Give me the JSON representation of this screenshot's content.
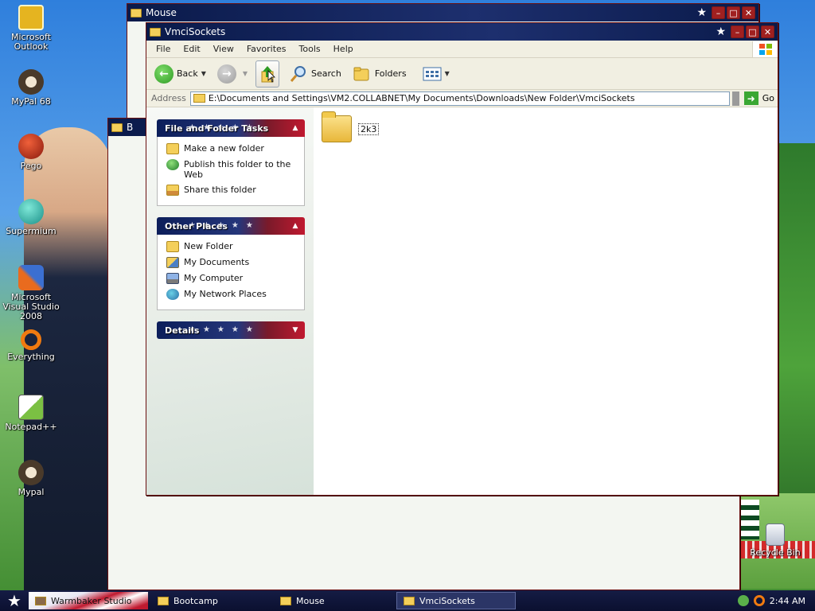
{
  "desktop": {
    "icons": [
      {
        "label": "Microsoft Outlook",
        "icon": "outlook-icon",
        "color": "#e5b420"
      },
      {
        "label": "MyPal 68",
        "icon": "raccoon-icon",
        "color": "#4a3a2a"
      },
      {
        "label": "Pego",
        "icon": "pego-icon",
        "color": "#c0301e"
      },
      {
        "label": "Supermium",
        "icon": "supermium-icon",
        "color": "#2ab7b0"
      },
      {
        "label": "Microsoft Visual Studio 2008",
        "icon": "visual-studio-icon",
        "color": "#e96b1e"
      },
      {
        "label": "Everything",
        "icon": "everything-icon",
        "color": "#f07a10"
      },
      {
        "label": "Notepad++",
        "icon": "notepadpp-icon",
        "color": "#7bc043"
      },
      {
        "label": "Mypal",
        "icon": "raccoon-icon",
        "color": "#4a3a2a"
      },
      {
        "label": "Recycle Bin",
        "icon": "recycle-bin-icon",
        "color": "#d8dde6"
      }
    ]
  },
  "back_windows": [
    {
      "title": "Mouse"
    },
    {
      "title": "B"
    }
  ],
  "window": {
    "title": "VmciSockets",
    "menu": [
      "File",
      "Edit",
      "View",
      "Favorites",
      "Tools",
      "Help"
    ],
    "toolbar": {
      "back": "Back",
      "search": "Search",
      "folders": "Folders"
    },
    "address": {
      "label": "Address",
      "value": "E:\\Documents and Settings\\VM2.COLLABNET\\My Documents\\Downloads\\New Folder\\VmciSockets",
      "go": "Go"
    },
    "panels": {
      "tasks": {
        "title": "File and Folder Tasks",
        "items": [
          "Make a new folder",
          "Publish this folder to the Web",
          "Share this folder"
        ]
      },
      "places": {
        "title": "Other Places",
        "items": [
          "New Folder",
          "My Documents",
          "My Computer",
          "My Network Places"
        ]
      },
      "details": {
        "title": "Details"
      }
    },
    "files": [
      {
        "name": "2k3",
        "icon": "folder-icon"
      }
    ]
  },
  "taskbar": {
    "tasks": [
      "Warmbaker Studio",
      "Bootcamp",
      "Mouse",
      "VmciSockets"
    ],
    "active": "VmciSockets",
    "clock": "2:44 AM"
  },
  "colors": {
    "title_navy": "#0a1a4a",
    "flag_red": "#c0192f",
    "folder_yellow": "#f4cf5a"
  }
}
